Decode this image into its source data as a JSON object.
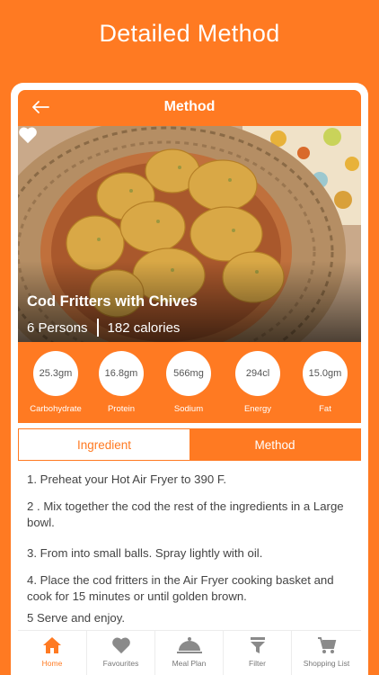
{
  "header": {
    "title": "Detailed Method"
  },
  "nav": {
    "title": "Method",
    "back_icon": "back-arrow-icon"
  },
  "recipe": {
    "name": "Cod Fritters with Chives",
    "persons": "6 Persons",
    "calories": "182 calories",
    "favorite_icon": "heart-icon"
  },
  "nutrition": [
    {
      "value": "25.3gm",
      "label": "Carbohydrate"
    },
    {
      "value": "16.8gm",
      "label": "Protein"
    },
    {
      "value": "566mg",
      "label": "Sodium"
    },
    {
      "value": "294cl",
      "label": "Energy"
    },
    {
      "value": "15.0gm",
      "label": "Fat"
    }
  ],
  "tabs": {
    "ingredient": "Ingredient",
    "method": "Method",
    "selected": "Method"
  },
  "steps": [
    "1. Preheat your Hot Air Fryer to 390 F.",
    "2 . Mix together the cod the rest of the ingredients in a Large bowl.",
    "3. From into small balls. Spray lightly with oil.",
    "4. Place the cod fritters in the Air Fryer cooking basket  and cook for 15 minutes or until golden brown.",
    "5 Serve and enjoy."
  ],
  "tabbar": [
    {
      "label": "Home",
      "icon": "home-icon",
      "active": true
    },
    {
      "label": "Favourites",
      "icon": "heart-icon",
      "active": false
    },
    {
      "label": "Meal Plan",
      "icon": "cloche-icon",
      "active": false
    },
    {
      "label": "Filter",
      "icon": "filter-icon",
      "active": false
    },
    {
      "label": "Shopping List",
      "icon": "cart-icon",
      "active": false
    }
  ],
  "colors": {
    "accent": "#ff7a22",
    "text": "#444444",
    "white": "#ffffff"
  }
}
